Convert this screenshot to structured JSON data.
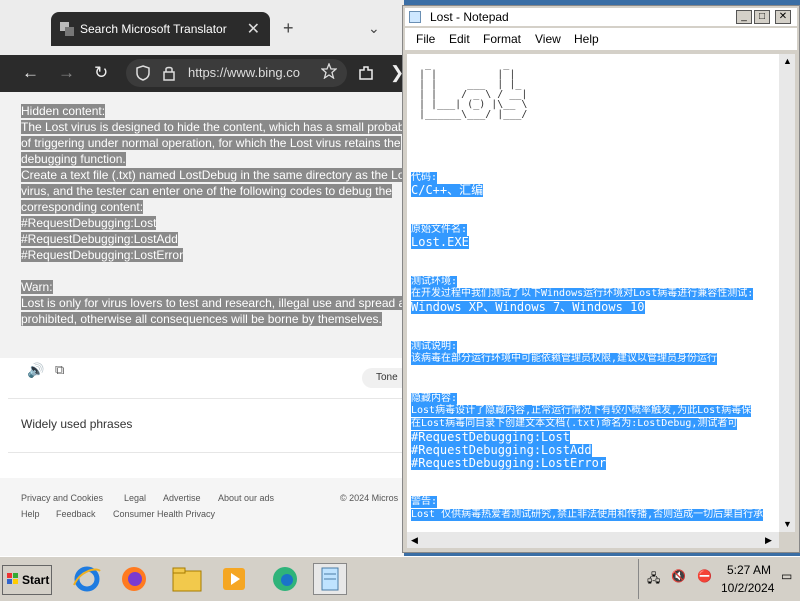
{
  "browser": {
    "tab_title": "Search Microsoft Translator",
    "tab_close": "✕",
    "new_tab": "+",
    "tab_dropdown": "⌄",
    "url": "https://www.bing.co",
    "back": "←",
    "forward": "→",
    "reload": "↻",
    "more": "❯",
    "translated_lines": [
      "Hidden content:",
      "The Lost virus is designed to hide the content, which has a small probab",
      "of triggering under normal operation, for which the Lost virus retains the",
      "debugging function.",
      "Create a text file (.txt) named LostDebug in the same directory as the Los",
      "virus, and the tester can enter one of the following codes to debug the",
      "corresponding content:",
      "#RequestDebugging:Lost",
      "#RequestDebugging:LostAdd",
      "#RequestDebugging:LostError",
      "",
      "Warn:",
      "Lost is only for virus lovers to test and research, illegal use and spread are",
      "prohibited, otherwise all consequences will be borne by themselves."
    ],
    "tone_label": "Tone",
    "phrases_heading": "Widely used phrases",
    "footer": {
      "privacy": "Privacy and Cookies",
      "legal": "Legal",
      "advertise": "Advertise",
      "about": "About our ads",
      "copyright": "© 2024 Micros",
      "help": "Help",
      "feedback": "Feedback",
      "consumer": "Consumer Health Privacy"
    }
  },
  "notepad": {
    "title": "Lost - Notepad",
    "menu": [
      "File",
      "Edit",
      "Format",
      "View",
      "Help"
    ],
    "ascii_art": "  _            _      \n | |          | |     \n | |     ___  | |_    \n | |    / _ \\ / __|   \n | |___| (_) |\\__ \\   \n |______\\___/ |___/   ",
    "lines": {
      "code_label": "代码:",
      "code_value": "C/C++、汇编",
      "file_label": "原始文件名:",
      "file_value": "Lost.EXE",
      "env_label": "测试环境:",
      "env_desc": "在开发过程中我们测试了以下Windows运行环境对Lost病毒进行兼容性测试:",
      "env_value": "Windows XP、Windows 7、Windows 10",
      "note_label": "测试说明:",
      "note_value": "该病毒在部分运行环境中可能依赖管理员权限,建议以管理员身份运行",
      "hidden_label": "隐藏内容:",
      "hidden_desc1": "Lost病毒设计了隐藏内容,正常运行情况下有较小概率触发,为此Lost病毒保",
      "hidden_desc2": "在Lost病毒同目录下创建文本文档(.txt)命名为:LostDebug,测试者可",
      "debug1": "#RequestDebugging:Lost",
      "debug2": "#RequestDebugging:LostAdd",
      "debug3": "#RequestDebugging:LostError",
      "warn_label": "警告:",
      "warn_value": "Lost  仅供病毒热爱者测试研究,禁止非法使用和传播,否则造成一切后果自行承"
    }
  },
  "taskbar": {
    "start_label": "Start",
    "time": "5:27 AM",
    "date": "10/2/2024"
  }
}
